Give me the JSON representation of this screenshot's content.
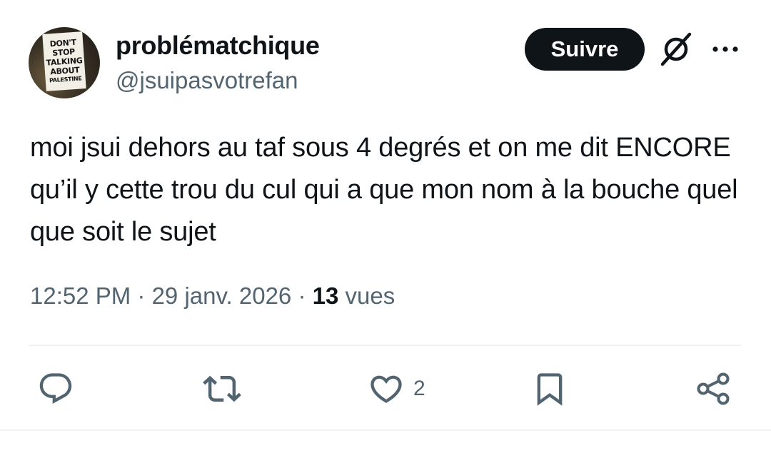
{
  "tweet": {
    "avatar_sign_lines": [
      "DON'T",
      "STOP",
      "TALKING",
      "ABOUT",
      "PALESTINE"
    ],
    "display_name": "problématchique",
    "handle": "@jsuipasvotrefan",
    "follow_label": "Suivre",
    "text": "moi jsui dehors au taf sous 4 degrés et on me dit ENCORE qu’il y cette trou du cul qui a que mon nom à la bouche quel que soit le sujet",
    "time": "12:52 PM",
    "separator": " · ",
    "date": "29 janv. 2026",
    "views_count": "13",
    "views_label": "vues"
  },
  "actions": {
    "reply_icon": "reply-icon",
    "retweet_icon": "retweet-icon",
    "like_icon": "like-icon",
    "like_count": "2",
    "bookmark_icon": "bookmark-icon",
    "share_icon": "share-icon"
  },
  "colors": {
    "text": "#0f1419",
    "secondary": "#536471",
    "button_bg": "#0f1419",
    "divider": "#eff3f4"
  }
}
